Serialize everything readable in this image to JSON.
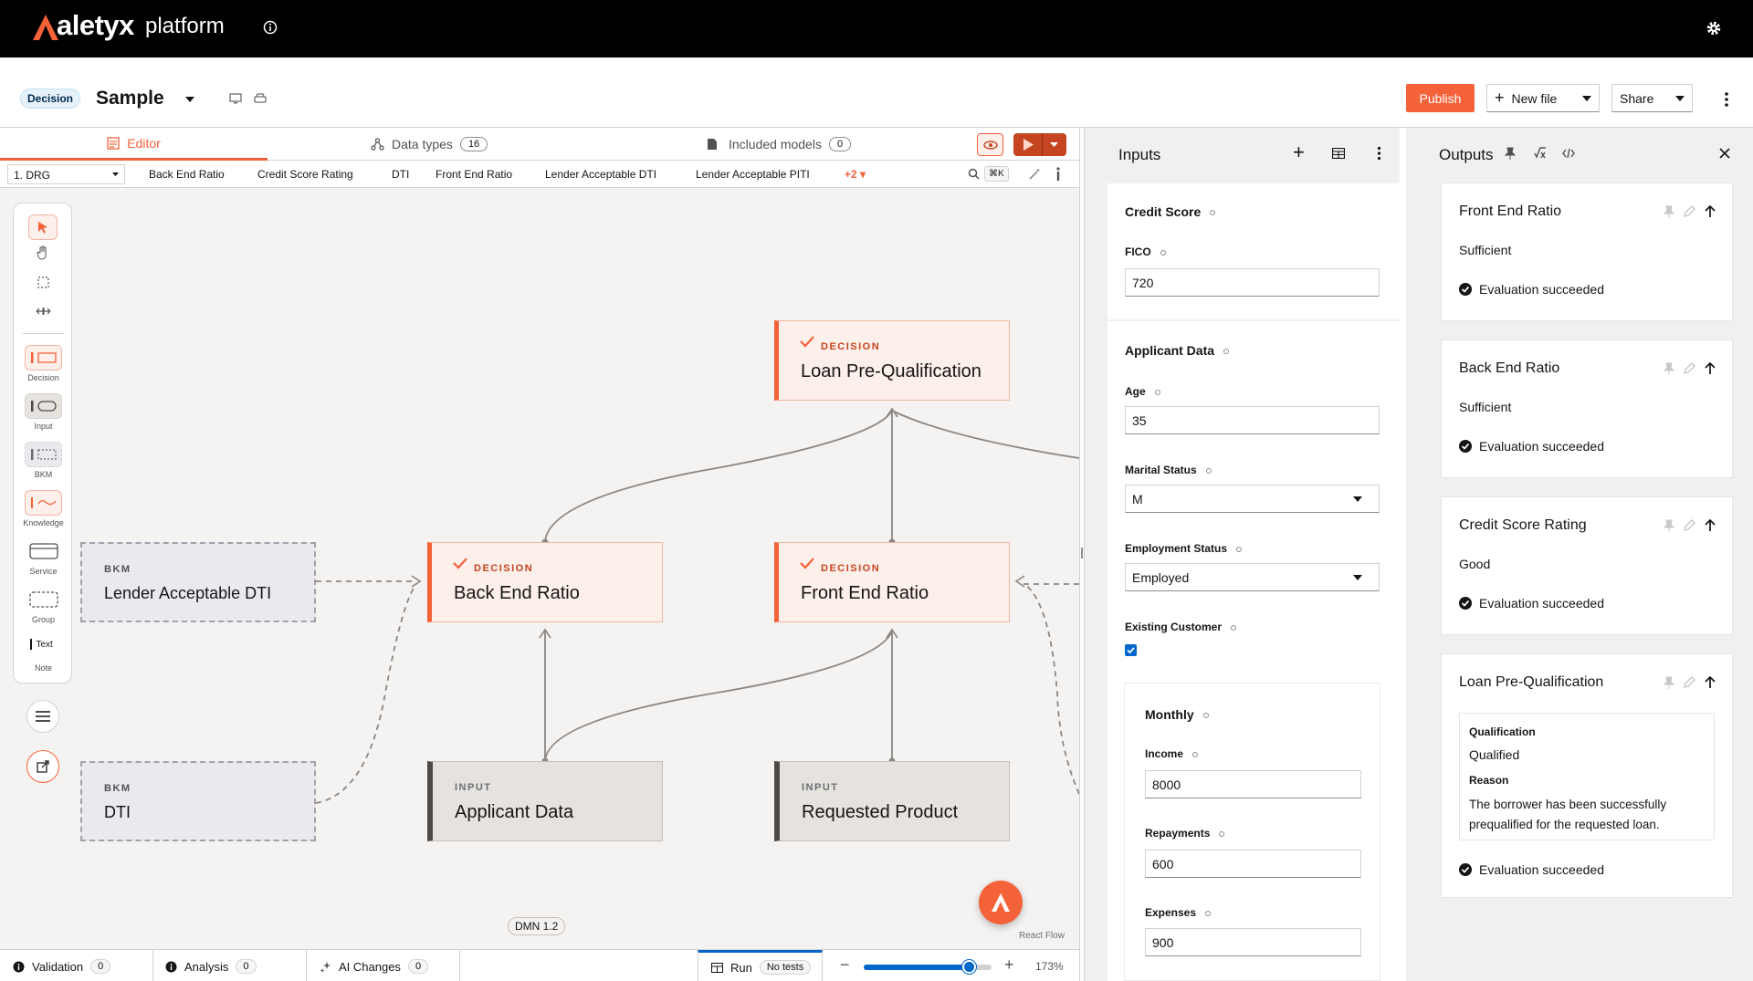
{
  "app": {
    "brand": "aletyx",
    "product": "platform"
  },
  "header": {
    "badge": "Decision",
    "title": "Sample",
    "publish": "Publish",
    "new_file": "New file",
    "share": "Share"
  },
  "tabs": [
    {
      "label": "Editor"
    },
    {
      "label": "Data types",
      "count": "16"
    },
    {
      "label": "Included models",
      "count": "0"
    }
  ],
  "nav": {
    "drg": "1. DRG",
    "items": [
      "Back End Ratio",
      "Credit Score Rating",
      "DTI",
      "Front End Ratio",
      "Lender Acceptable DTI",
      "Lender Acceptable PITI"
    ],
    "more": "+2",
    "shortcut": "⌘K"
  },
  "palette": [
    "Decision",
    "Input",
    "BKM",
    "Knowledge",
    "Service",
    "Group",
    "Text",
    "Note"
  ],
  "nodes": {
    "loan": {
      "kind": "DECISION",
      "name": "Loan Pre-Qualification"
    },
    "back": {
      "kind": "DECISION",
      "name": "Back End Ratio"
    },
    "front": {
      "kind": "DECISION",
      "name": "Front End Ratio"
    },
    "applicant": {
      "kind": "INPUT",
      "name": "Applicant Data"
    },
    "product": {
      "kind": "INPUT",
      "name": "Requested Product"
    },
    "bkm_dti_acc": {
      "kind": "BKM",
      "name": "Lender Acceptable DTI"
    },
    "bkm_dti": {
      "kind": "BKM",
      "name": "DTI"
    }
  },
  "canvas": {
    "dmn": "DMN 1.2",
    "reactflow": "React Flow"
  },
  "bottom": {
    "validation": "Validation",
    "validation_count": "0",
    "analysis": "Analysis",
    "analysis_count": "0",
    "ai": "AI Changes",
    "ai_count": "0",
    "run": "Run",
    "tests": "No tests",
    "zoom": "173%",
    "zoom_level": 0.82
  },
  "inputs": {
    "title": "Inputs",
    "credit_score": "Credit Score",
    "fico": "FICO",
    "fico_value": "720",
    "applicant": "Applicant Data",
    "age": "Age",
    "age_value": "35",
    "marital": "Marital Status",
    "marital_value": "M",
    "employment": "Employment Status",
    "employment_value": "Employed",
    "existing": "Existing Customer",
    "monthly": "Monthly",
    "income": "Income",
    "income_value": "8000",
    "repayments": "Repayments",
    "repayments_value": "600",
    "expenses": "Expenses",
    "expenses_value": "900"
  },
  "outputs": {
    "title": "Outputs",
    "cards": [
      {
        "title": "Front End Ratio",
        "value": "Sufficient",
        "status": "Evaluation succeeded"
      },
      {
        "title": "Back End Ratio",
        "value": "Sufficient",
        "status": "Evaluation succeeded"
      },
      {
        "title": "Credit Score Rating",
        "value": "Good",
        "status": "Evaluation succeeded"
      }
    ],
    "loan": {
      "title": "Loan Pre-Qualification",
      "q_label": "Qualification",
      "q_value": "Qualified",
      "r_label": "Reason",
      "r_value": "The borrower has been successfully prequalified for the requested loan.",
      "status": "Evaluation succeeded"
    }
  }
}
